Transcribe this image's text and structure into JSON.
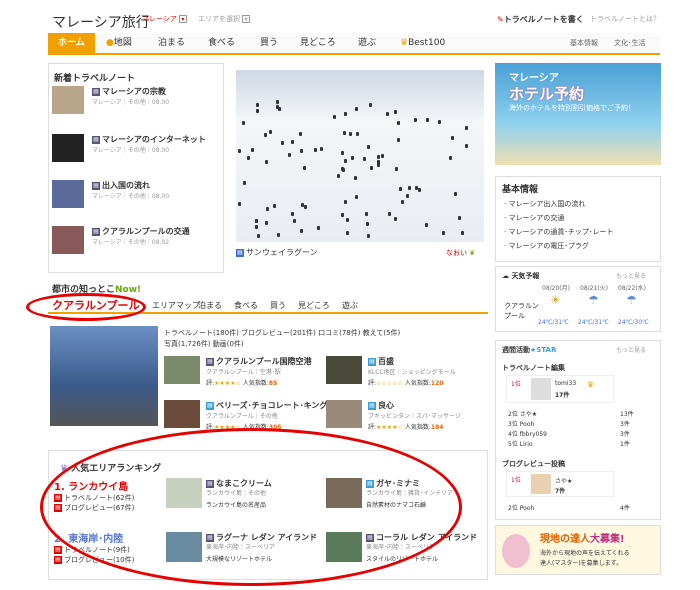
{
  "header": {
    "title": "マレーシア旅行",
    "country_select": "マレーシア",
    "area_select": "エリアを選択",
    "write_note": "トラベルノートを書く",
    "what_is": "トラベルノートとは？"
  },
  "nav": {
    "home": "ホーム",
    "items": [
      "地図",
      "泊まる",
      "食べる",
      "買う",
      "見どころ",
      "遊ぶ",
      "Best100"
    ],
    "sub": [
      "基本情報",
      "文化･生活"
    ]
  },
  "notes": {
    "heading": "新着トラベルノート",
    "items": [
      {
        "title": "マレーシアの宗教",
        "meta": "マレーシア｜その他｜08.00"
      },
      {
        "title": "マレーシアのインターネット",
        "meta": "マレーシア｜その他｜08.00"
      },
      {
        "title": "出入国の流れ",
        "meta": "マレーシア｜その他｜08.00"
      },
      {
        "title": "クアラルンプールの交通",
        "meta": "マレーシア｜その他｜08.02"
      }
    ]
  },
  "feature": {
    "caption": "サンウェイラグーン",
    "rating": "なおい"
  },
  "banner": {
    "line1": "マレーシア",
    "line2": "ホテル予約",
    "line3": "海外のホテルを特別割引価格でご予約！"
  },
  "info": {
    "heading": "基本情報",
    "items": [
      "マレーシア出入国の流れ",
      "マレーシアの交通",
      "マレーシアの通貨･チップ･レート",
      "マレーシアの電圧･プラグ"
    ]
  },
  "weather": {
    "heading": "天気予報",
    "more": "もっと見る",
    "dates": [
      "08/20(月)",
      "08/21(火)",
      "08/22(水)"
    ],
    "city": "クアラルンプール",
    "temps": [
      "24℃/31℃",
      "24℃/31℃",
      "24℃/30℃"
    ]
  },
  "city": {
    "heading": "都市の知っとこ",
    "now": "Now!",
    "tabs": [
      "クアラルンプール",
      "エリアマップ",
      "泊まる",
      "食べる",
      "買う",
      "見どころ",
      "遊ぶ"
    ],
    "links1": "トラベルノート(180件)  ブログレビュー(201件)  口コミ(78件)  教えて(5件)",
    "links2": "写真(1,726件)  動画(0件)"
  },
  "spots": [
    {
      "name": "クアラルンプール国際空港",
      "sub": "クアラルンプール｜空港･駅",
      "score": "85"
    },
    {
      "name": "百盛",
      "sub": "KLCC地区｜ショッピングモール",
      "score": "120"
    },
    {
      "name": "ベリーズ･チョコレート･キング",
      "sub": "クアラルンプール｜その他",
      "score": "305"
    },
    {
      "name": "良心",
      "sub": "ブキッビンタン｜スパ･マッサージ",
      "score": "184"
    }
  ],
  "score_label": "評:",
  "popularity_label": "人気指数:",
  "weekly": {
    "heading": "週間活動",
    "star": "STAR",
    "more": "もっと見る",
    "sec1": "トラベルノート編集",
    "first": {
      "rank": "1位",
      "name": "tomi33",
      "count": "17件"
    },
    "rows": [
      {
        "rank": "2位",
        "name": "さや★",
        "count": "13件"
      },
      {
        "rank": "3位",
        "name": "Pooh",
        "count": "3件"
      },
      {
        "rank": "4位",
        "name": "fbbry059",
        "count": "3件"
      },
      {
        "rank": "5位",
        "name": "Lirio",
        "count": "1件"
      }
    ],
    "sec2": "ブログレビュー投稿",
    "first2": {
      "rank": "1位",
      "name": "さや★",
      "count": "7件"
    },
    "row2": {
      "rank": "2位",
      "name": "Pooh",
      "count": "4件"
    }
  },
  "area": {
    "heading": "人気エリアランキング",
    "r1": {
      "name": "1. ランカウイ島",
      "note": "トラベルノート(62件)",
      "blog": "ブログレビュー(67件)"
    },
    "r2": {
      "name": "2. 東海岸･内陸",
      "note": "トラベルノート(9件)",
      "blog": "ブログレビュー(10件)"
    },
    "cards": [
      {
        "name": "なまこクリーム",
        "sub": "ランカウイ島｜その他",
        "desc": "ランカウイ島の名産品"
      },
      {
        "name": "ガヤ･ミナミ",
        "sub": "ランカウイ島｜雑貨･インテリア",
        "desc": "自然素材のナマコ石鹸"
      },
      {
        "name": "ラグーナ レダン アイランド",
        "sub": "東海岸･内陸｜スーベリア",
        "desc": "大規模なリゾートホテル"
      },
      {
        "name": "コーラル レダン アイランド",
        "sub": "東海岸･内陸｜スーベリア",
        "desc": "スタイルのリゾートホテル"
      }
    ]
  },
  "master": {
    "title": "現地の達人",
    "sub": "大募集!",
    "desc1": "海外から現地の声を伝えてくれる",
    "desc2": "達人(マスター)を募集します。"
  }
}
